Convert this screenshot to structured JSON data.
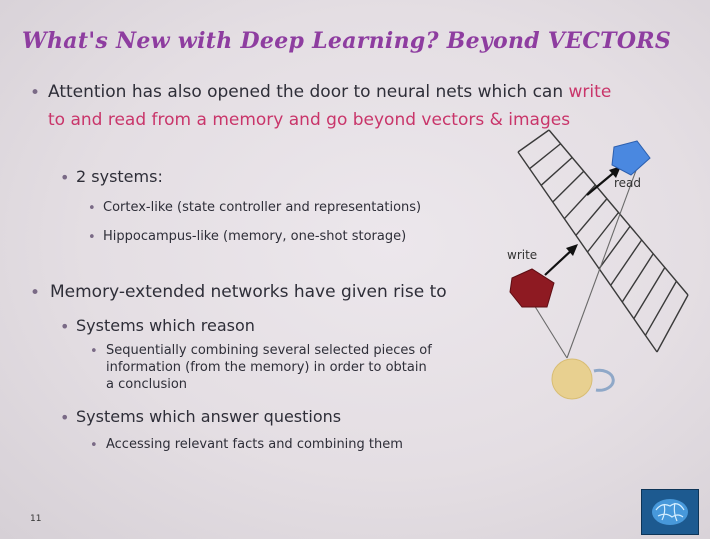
{
  "title": "What's New with Deep Learning? Beyond VECTORS",
  "bullets": {
    "b1_line1_plain": "Attention has also opened the door to neural nets which can ",
    "b1_line1_accent": "write",
    "b1_line2_accent": "to and read from a memory and go beyond vectors & images",
    "b1_sub": "2 systems:",
    "b1_sub_items": [
      "Cortex-like (state controller and representations)",
      "Hippocampus-like (memory, one-shot storage)"
    ],
    "b2": "Memory-extended networks have given rise to",
    "b2_sub1": "Systems which reason",
    "b2_sub1_detail": [
      "Sequentially combining several selected pieces of",
      "information (from the memory) in order to obtain",
      "a conclusion"
    ],
    "b2_sub2": "Systems which answer questions",
    "b2_sub2_detail": "Accessing relevant facts and combining them"
  },
  "diagram": {
    "read_label": "read",
    "write_label": "write",
    "colors": {
      "read_head": "#4a88e0",
      "write_head": "#8e1a22",
      "controller": "#e8d090",
      "memory_tape": "#3a3a3a"
    }
  },
  "footer": {
    "slide_number": "11"
  },
  "logo_icon": "brain-icon"
}
